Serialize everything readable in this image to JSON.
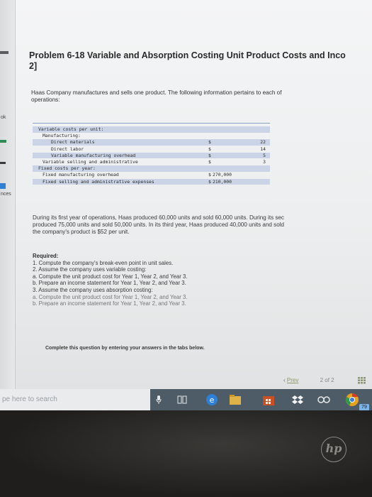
{
  "sidebar": {
    "labels": [
      "ok",
      "nces"
    ]
  },
  "problem": {
    "title_line1": "Problem 6-18 Variable and Absorption Costing Unit Product Costs and Inco",
    "title_line2": "2]",
    "intro_line1": "Haas Company manufactures and sells one product. The following information pertains to each of",
    "intro_line2": "operations:"
  },
  "cost_table": {
    "rows": [
      {
        "label": "Variable costs per unit:",
        "dollar": "",
        "amount": "",
        "indent": 0
      },
      {
        "label": "Manufacturing:",
        "dollar": "",
        "amount": "",
        "indent": 1
      },
      {
        "label": "Direct materials",
        "dollar": "$",
        "amount": "22",
        "indent": 2
      },
      {
        "label": "Direct labor",
        "dollar": "$",
        "amount": "14",
        "indent": 2
      },
      {
        "label": "Variable manufacturing overhead",
        "dollar": "$",
        "amount": "5",
        "indent": 2
      },
      {
        "label": "Variable selling and administrative",
        "dollar": "$",
        "amount": "3",
        "indent": 1
      },
      {
        "label": "Fixed costs per year:",
        "dollar": "",
        "amount": "",
        "indent": 0
      },
      {
        "label": "Fixed manufacturing overhead",
        "dollar": "$",
        "amount": "270,000",
        "indent": 1
      },
      {
        "label": "Fixed selling and administrative expenses",
        "dollar": "$",
        "amount": "210,000",
        "indent": 1
      }
    ]
  },
  "paragraph": {
    "line1": "During its first year of operations, Haas produced 60,000 units and sold 60,000 units. During its sec",
    "line2": "produced 75,000 units and sold 50,000 units. In its third year, Haas produced 40,000 units and sold",
    "line3": "the company's product is $52 per unit."
  },
  "required": {
    "heading": "Required:",
    "items": [
      "1. Compute the company's break-even point in unit sales.",
      "2. Assume the company uses variable costing:",
      "a. Compute the unit product cost for Year 1, Year 2, and Year 3.",
      "b. Prepare an income statement for Year 1, Year 2, and Year 3.",
      "3. Assume the company uses absorption costing:",
      "a. Compute the unit product cost for Year 1, Year 2, and Year 3.",
      "b. Prepare an income statement for Year 1, Year 2, and Year 3."
    ]
  },
  "footer": {
    "complete_note": "Complete this question by entering your answers in the tabs below.",
    "prev_label": "Prev",
    "page_indicator": "2 of 2"
  },
  "taskbar": {
    "search_placeholder": "pe here to search",
    "badge": "79"
  },
  "brand": {
    "logo_text": "hp"
  },
  "colors": {
    "table_shade": "#cad4e6",
    "taskbar": "#4e5c67",
    "edge_blue": "#2f7fd6",
    "chrome_orange": "#e7a11d"
  }
}
